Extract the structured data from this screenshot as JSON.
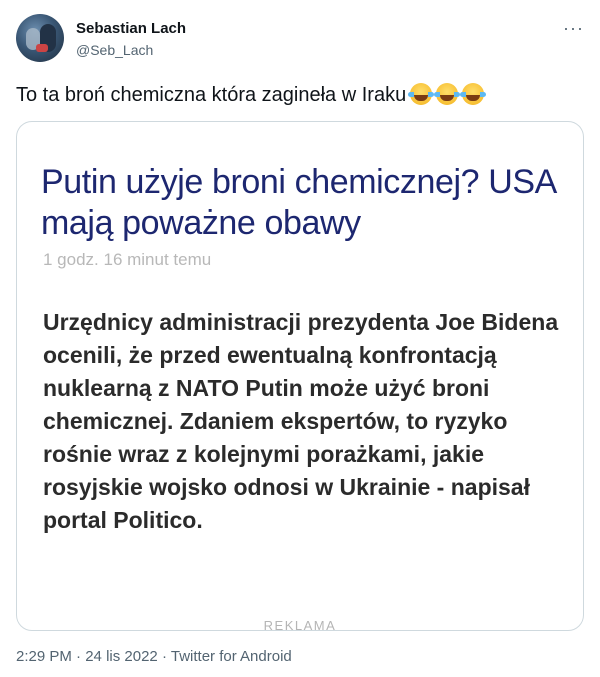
{
  "author": {
    "name": "Sebastian Lach",
    "handle": "@Seb_Lach"
  },
  "tweet": {
    "text": "To ta broń chemiczna która zagineła w Iraku",
    "emoji": [
      "face-with-tears-of-joy",
      "face-with-tears-of-joy",
      "face-with-tears-of-joy"
    ],
    "more_icon": "more-horizontal-icon"
  },
  "article": {
    "headline": "Putin użyje broni chemicznej? USA mają poważne obawy",
    "time_ago": "1 godz. 16 minut temu",
    "lead": "Urzędnicy administracji prezydenta Joe Bidena ocenili, że przed ewentualną konfrontacją nuklearną z NATO Putin może użyć broni chemicznej. Zdaniem ekspertów, to ryzyko rośnie wraz z kolejnymi porażkami, jakie rosyjskie wojsko odnosi w Ukrainie - napisał portal Politico.",
    "ad_label": "REKLAMA"
  },
  "meta": {
    "time": "2:29 PM",
    "separator": "·",
    "date": "24 lis 2022",
    "source": "Twitter for Android"
  },
  "colors": {
    "headline": "#1d2770",
    "secondary_text": "#536471",
    "card_border": "#cfd9de"
  }
}
